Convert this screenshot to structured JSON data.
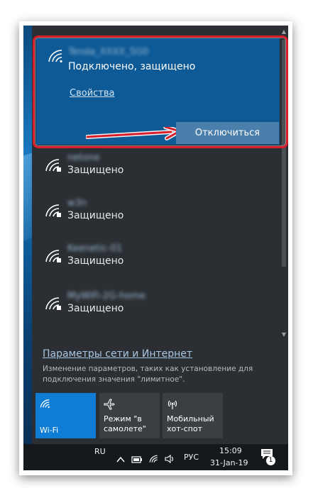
{
  "connected_network": {
    "name": "Tenda_XXXX_5G0",
    "status": "Подключено, защищено",
    "properties_link": "Свойства",
    "disconnect_button": "Отключиться"
  },
  "networks": [
    {
      "name": "netone",
      "status": "Защищено"
    },
    {
      "name": "w3n",
      "status": "Защищено"
    },
    {
      "name": "Keenetic-01",
      "status": "Защищено"
    },
    {
      "name": "MyWiFi-2G-home",
      "status": "Защищено"
    }
  ],
  "settings": {
    "link": "Параметры сети и Интернет",
    "description": "Изменение параметров, таких как установление для подключения значения \"лимитное\"."
  },
  "quick_actions": [
    {
      "label": "Wi-Fi",
      "icon": "wifi-icon",
      "active": true
    },
    {
      "label": "Режим \"в самолете\"",
      "icon": "airplane-icon",
      "active": false
    },
    {
      "label": "Мобильный хот-спот",
      "icon": "hotspot-icon",
      "active": false
    }
  ],
  "taskbar": {
    "language_short": "RU",
    "language": "РУС",
    "time": "15:09",
    "date": "31-Jan-19",
    "notification_count": "1"
  },
  "colors": {
    "accent": "#0e5a96",
    "highlight": "#d81e2b",
    "tile_active": "#0f7dd6"
  }
}
